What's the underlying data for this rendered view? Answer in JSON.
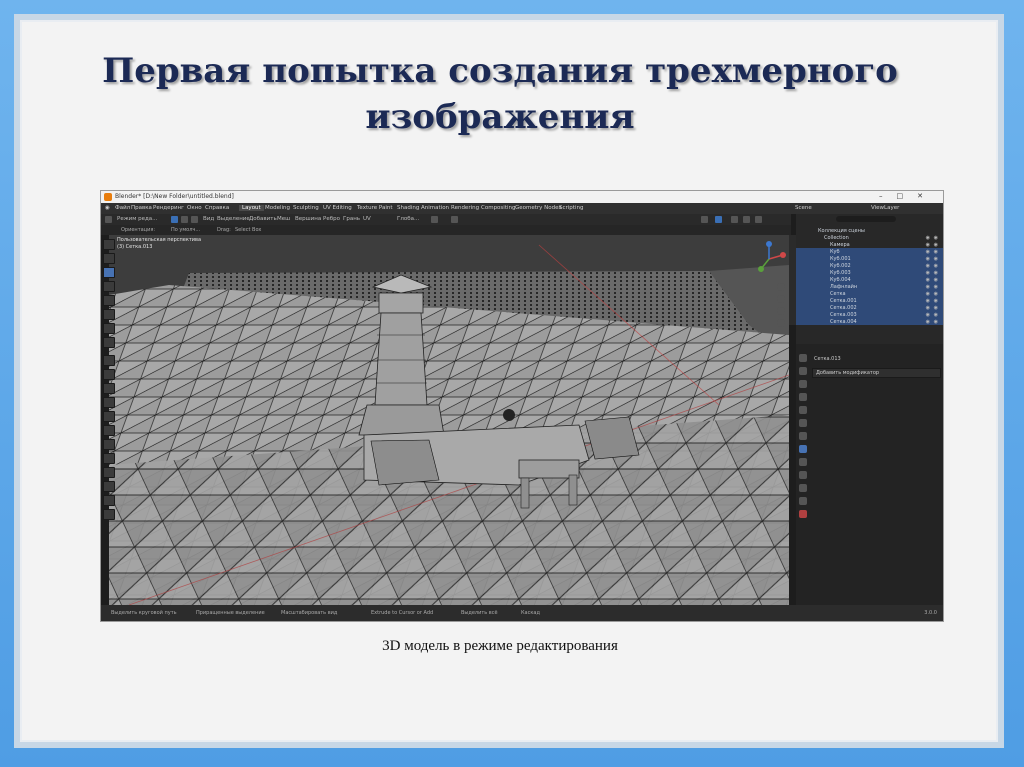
{
  "slide": {
    "title": "Первая попытка создания трехмерного изображения",
    "caption": "3D модель в режиме редактирования"
  },
  "window": {
    "title": "Blender* [D:\\New Folder\\untitled.blend]",
    "menu": [
      "Файл",
      "Правка",
      "Рендеринг",
      "Окно",
      "Справка"
    ],
    "workspace_tabs": [
      "Layout",
      "Modeling",
      "Sculpting",
      "UV Editing",
      "Texture Paint",
      "Shading",
      "Animation",
      "Rendering",
      "Compositing",
      "Geometry Nodes",
      "Scripting"
    ],
    "active_tab": "Layout",
    "scene": "Scene",
    "view_layer": "ViewLayer"
  },
  "toolbar": {
    "mode": "Режим редa...",
    "items": [
      "Вид",
      "Выделение",
      "Добавить",
      "Меш",
      "Вершина",
      "Ребро",
      "Грань",
      "UV"
    ],
    "transform": "Глоба...",
    "orientation_label": "Ориентация:",
    "orientation_value": "По умолч...",
    "drag_label": "Drag:",
    "drag_value": "Select Box"
  },
  "viewport": {
    "view_name": "Пользовательская перспектива",
    "object": "(3) Сетка.013"
  },
  "outliner": {
    "rows": [
      {
        "label": "Коллекция сцены",
        "selected": false
      },
      {
        "label": "Collection",
        "selected": false
      },
      {
        "label": "Камера",
        "selected": false
      },
      {
        "label": "Куб",
        "selected": true
      },
      {
        "label": "Куб.001",
        "selected": true
      },
      {
        "label": "Куб.002",
        "selected": true
      },
      {
        "label": "Куб.003",
        "selected": true
      },
      {
        "label": "Куб.004",
        "selected": true
      },
      {
        "label": "Лафнлайн",
        "selected": true
      },
      {
        "label": "Сетка",
        "selected": true
      },
      {
        "label": "Сетка.001",
        "selected": true
      },
      {
        "label": "Сетка.002",
        "selected": true
      },
      {
        "label": "Сетка.003",
        "selected": true
      },
      {
        "label": "Сетка.004",
        "selected": true
      }
    ]
  },
  "properties": {
    "object_name": "Сетка.013",
    "add_modifier": "Добавить модификатор"
  },
  "statusbar": {
    "items": [
      "Выделить круговой путь",
      "Приращенные выделение",
      "Масштабировать вид",
      "Extrude to Cursor or Add",
      "Выделить всё",
      "Каскад"
    ],
    "version": "3.0.0"
  },
  "colors": {
    "frame": "#5aa6ea",
    "title": "#1c2a55",
    "selection": "#2f4a78",
    "active": "#4772b3",
    "blender_orange": "#e87d0d"
  }
}
